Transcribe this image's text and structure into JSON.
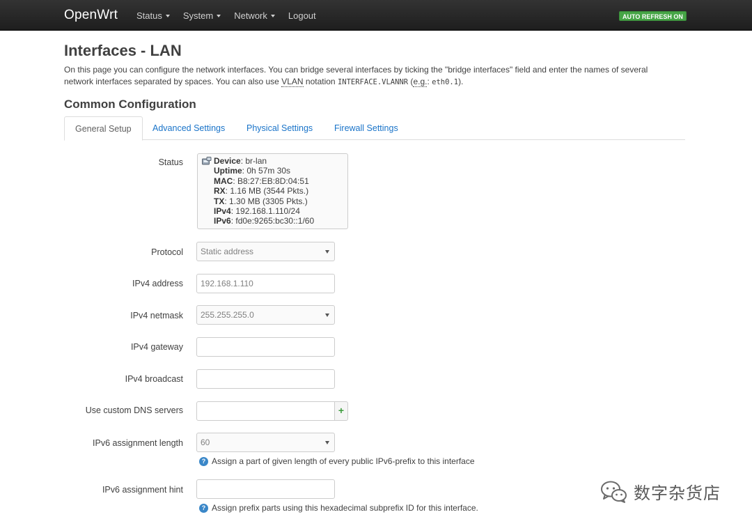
{
  "navbar": {
    "brand": "OpenWrt",
    "menu": [
      {
        "label": "Status",
        "dropdown": true
      },
      {
        "label": "System",
        "dropdown": true
      },
      {
        "label": "Network",
        "dropdown": true
      },
      {
        "label": "Logout",
        "dropdown": false
      }
    ],
    "auto_refresh": "AUTO REFRESH ON"
  },
  "page": {
    "title": "Interfaces - LAN",
    "desc_part1": "On this page you can configure the network interfaces. You can bridge several interfaces by ticking the \"bridge interfaces\" field and enter the names of several network interfaces separated by spaces. You can also use ",
    "desc_vlan": "VLAN",
    "desc_part2": " notation ",
    "desc_code1": "INTERFACE.VLANNR",
    "desc_part3": " (",
    "desc_eg": "e.g.",
    "desc_part4": ": ",
    "desc_code2": "eth0.1",
    "desc_part5": ").",
    "section_title": "Common Configuration"
  },
  "tabs": [
    {
      "label": "General Setup",
      "active": true
    },
    {
      "label": "Advanced Settings",
      "active": false
    },
    {
      "label": "Physical Settings",
      "active": false
    },
    {
      "label": "Firewall Settings",
      "active": false
    }
  ],
  "status": {
    "label": "Status",
    "icon": "ethernet-port-icon",
    "lines": [
      {
        "key": "Device",
        "sep": ": ",
        "value": "br-lan"
      },
      {
        "key": "Uptime",
        "sep": ": ",
        "value": "0h 57m 30s"
      },
      {
        "key": "MAC",
        "sep": ": ",
        "value": "B8:27:EB:8D:04:51"
      },
      {
        "key": "RX",
        "sep": ": ",
        "value": "1.16 MB (3544 Pkts.)"
      },
      {
        "key": "TX",
        "sep": ": ",
        "value": "1.30 MB (3305 Pkts.)"
      },
      {
        "key": "IPv4",
        "sep": ": ",
        "value": "192.168.1.110/24"
      },
      {
        "key": "IPv6",
        "sep": ": ",
        "value": "fd0e:9265:bc30::1/60"
      }
    ]
  },
  "form": {
    "protocol": {
      "label": "Protocol",
      "value": "Static address"
    },
    "ipv4_address": {
      "label": "IPv4 address",
      "value": "192.168.1.110"
    },
    "ipv4_netmask": {
      "label": "IPv4 netmask",
      "value": "255.255.255.0"
    },
    "ipv4_gateway": {
      "label": "IPv4 gateway",
      "value": ""
    },
    "ipv4_broadcast": {
      "label": "IPv4 broadcast",
      "value": ""
    },
    "dns": {
      "label": "Use custom DNS servers",
      "value": "",
      "add": "+"
    },
    "ipv6_length": {
      "label": "IPv6 assignment length",
      "value": "60",
      "hint": "Assign a part of given length of every public IPv6-prefix to this interface"
    },
    "ipv6_hint": {
      "label": "IPv6 assignment hint",
      "value": "",
      "hint": "Assign prefix parts using this hexadecimal subprefix ID for this interface."
    }
  },
  "watermark": {
    "text": "数字杂货店",
    "icon": "wechat-icon"
  },
  "colors": {
    "navbar": "#222222",
    "link": "#1a74c9",
    "badge": "#46a546",
    "help": "#3a87c8"
  }
}
